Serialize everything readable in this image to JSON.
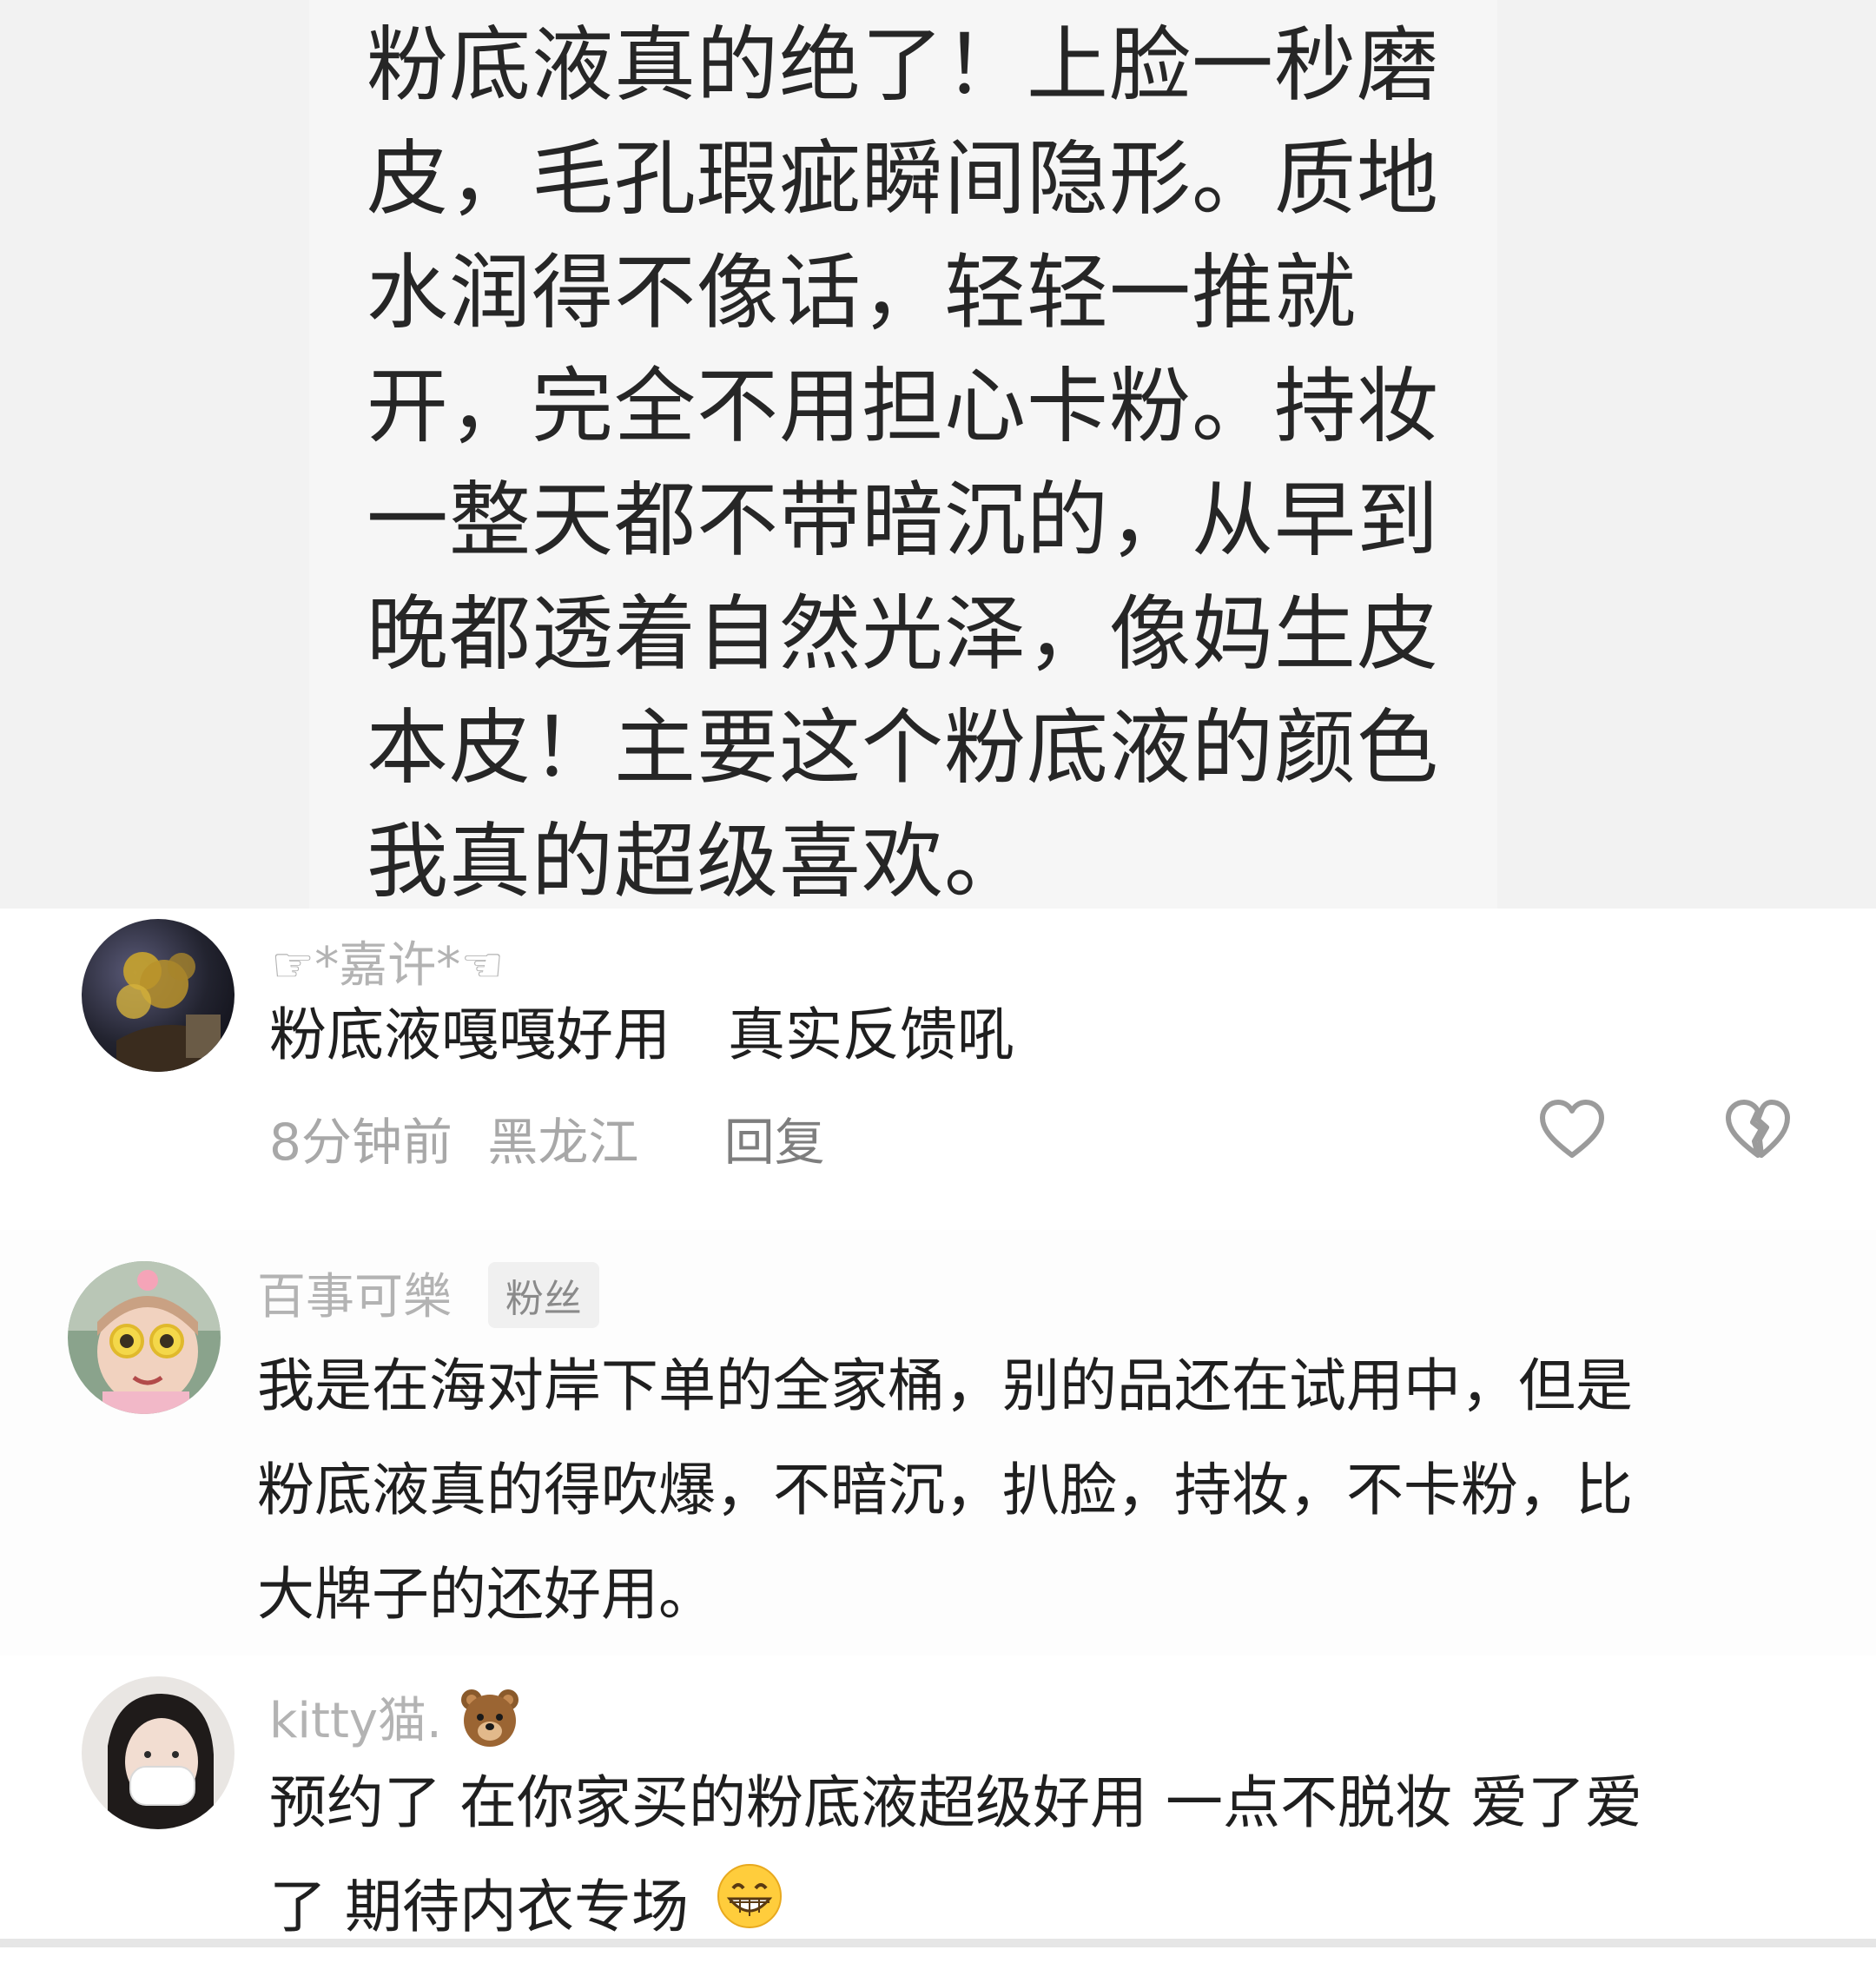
{
  "post": {
    "lines": [
      "粉底液真的绝了！上脸一秒磨",
      "皮，毛孔瑕疵瞬间隐形。质地",
      "水润得不像话，轻轻一推就",
      "开，完全不用担心卡粉。持妆",
      "一整天都不带暗沉的，从早到",
      "晚都透着自然光泽，像妈生皮",
      "本皮！主要这个粉底液的颜色",
      "我真的超级喜欢。"
    ]
  },
  "comments": [
    {
      "username": "☞*嘉许*☜",
      "text": "粉底液嘎嘎好用　真实反馈吼",
      "time": "8分钟前",
      "location": "黑龙江",
      "reply_label": "回复"
    },
    {
      "username": "百事可樂",
      "badge": "粉丝",
      "lines": [
        "我是在海对岸下单的全家桶，别的品还在试用中，但是",
        "粉底液真的得吹爆，不暗沉，扒脸，持妆，不卡粉，比",
        "大牌子的还好用。"
      ]
    },
    {
      "username": "kitty猫.",
      "username_emoji": "bear-face-emoji",
      "lines": [
        "预约了 在你家买的粉底液超级好用 一点不脱妆 爱了爱",
        "了 期待内衣专场"
      ],
      "end_emoji": "grinning-face-emoji"
    }
  ],
  "icons": {
    "like": "heart-outline-icon",
    "dislike": "broken-heart-outline-icon"
  },
  "colors": {
    "top_background": "#f2f2f2",
    "username": "#b3b3b3",
    "meta": "#a8a8a8",
    "badge_background": "#f0f0f0"
  }
}
